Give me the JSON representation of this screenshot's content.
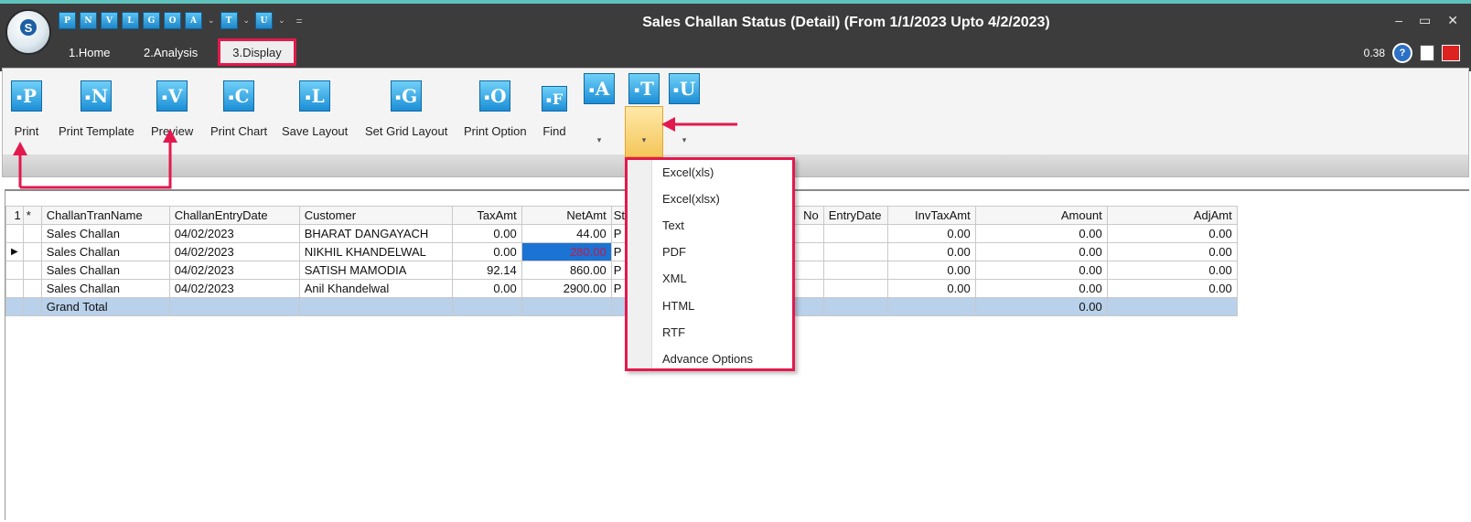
{
  "window": {
    "title": "Sales Challan Status (Detail)  (From 1/1/2023 Upto 4/2/2023)",
    "status_value": "0.38"
  },
  "qat": {
    "icons": [
      "P",
      "N",
      "V",
      "L",
      "G",
      "O",
      "A",
      "T",
      "U"
    ]
  },
  "tabs": [
    {
      "label": "1.Home",
      "active": false
    },
    {
      "label": "2.Analysis",
      "active": false
    },
    {
      "label": "3.Display",
      "active": true
    }
  ],
  "ribbon": {
    "buttons": [
      {
        "letter": "P",
        "label": "Print"
      },
      {
        "letter": "N",
        "label": "Print Template"
      },
      {
        "letter": "V",
        "label": "Preview"
      },
      {
        "letter": "C",
        "label": "Print Chart"
      },
      {
        "letter": "L",
        "label": "Save Layout"
      },
      {
        "letter": "G",
        "label": "Set Grid Layout"
      },
      {
        "letter": "O",
        "label": "Print Option"
      },
      {
        "letter": "F",
        "label": "Find"
      }
    ],
    "gallery": [
      {
        "letter": "A"
      },
      {
        "letter": "T",
        "highlighted": true
      },
      {
        "letter": "U"
      }
    ]
  },
  "export_menu": {
    "items": [
      "Excel(xls)",
      "Excel(xlsx)",
      "Text",
      "PDF",
      "XML",
      "HTML",
      "RTF",
      "Advance Options"
    ]
  },
  "grid": {
    "indicator_header": "1",
    "star_header": "*",
    "columns": [
      "ChallanTranName",
      "ChallanEntryDate",
      "Customer",
      "TaxAmt",
      "NetAmt",
      "St",
      "No",
      "EntryDate",
      "InvTaxAmt",
      "Amount",
      "AdjAmt"
    ],
    "rows": [
      {
        "name": "Sales Challan",
        "date": "04/02/2023",
        "customer": "BHARAT DANGAYACH",
        "tax": "0.00",
        "net": "44.00",
        "st": "P",
        "no": "",
        "entry": "",
        "invtax": "0.00",
        "amount": "0.00",
        "adj": "0.00"
      },
      {
        "name": "Sales Challan",
        "date": "04/02/2023",
        "customer": "NIKHIL KHANDELWAL",
        "tax": "0.00",
        "net": "280.00",
        "st": "P",
        "no": "",
        "entry": "",
        "invtax": "0.00",
        "amount": "0.00",
        "adj": "0.00"
      },
      {
        "name": "Sales Challan",
        "date": "04/02/2023",
        "customer": "SATISH MAMODIA",
        "tax": "92.14",
        "net": "860.00",
        "st": "P",
        "no": "",
        "entry": "",
        "invtax": "0.00",
        "amount": "0.00",
        "adj": "0.00"
      },
      {
        "name": "Sales Challan",
        "date": "04/02/2023",
        "customer": "Anil Khandelwal",
        "tax": "0.00",
        "net": "2900.00",
        "st": "P",
        "no": "",
        "entry": "",
        "invtax": "0.00",
        "amount": "0.00",
        "adj": "0.00"
      }
    ],
    "total": {
      "label": "Grand Total",
      "amount": "0.00"
    },
    "current_row_marker": "▶"
  },
  "colors": {
    "title_bar": "#3c3c3c",
    "accent_highlight": "#e3194d",
    "selection": "#1b73d3",
    "total_row": "#b9d1ea"
  }
}
